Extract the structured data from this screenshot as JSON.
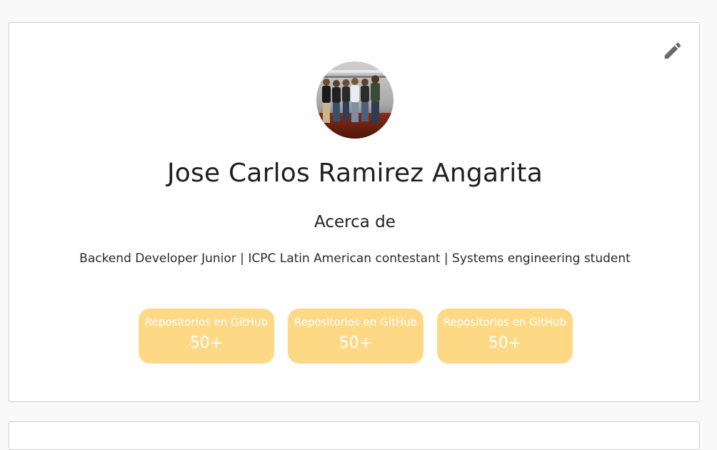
{
  "profile": {
    "name": "Jose Carlos Ramirez Angarita",
    "about_title": "Acerca de",
    "about_text": "Backend Developer Junior | ICPC Latin American contestant | Systems engineering student",
    "avatar_icon": "group-photo",
    "edit_icon": "pencil-icon"
  },
  "stats": [
    {
      "label": "Repositorios en GitHub",
      "value": "50+"
    },
    {
      "label": "Repositorios en GitHub",
      "value": "50+"
    },
    {
      "label": "Repositorios en GitHub",
      "value": "50+"
    }
  ],
  "colors": {
    "stat_bg": "#fdd985",
    "stat_text": "#ffffff",
    "edit_icon": "#6b6b6b"
  }
}
